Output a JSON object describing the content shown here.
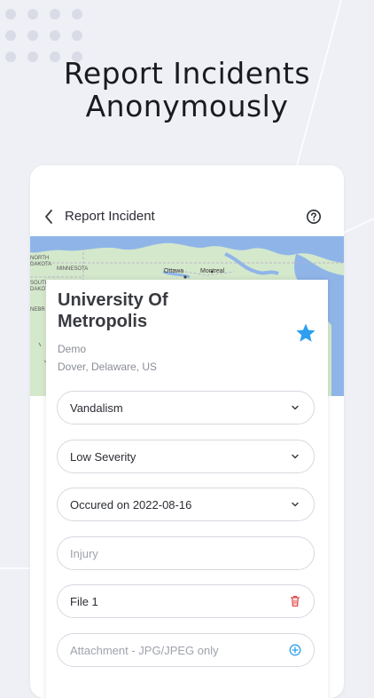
{
  "headline": {
    "line1": "Report Incidents",
    "line2": "Anonymously"
  },
  "appbar": {
    "title": "Report Incident"
  },
  "map": {
    "labels": [
      "NORTH",
      "DAKOTA",
      "MINNESOTA",
      "SOUTH",
      "DAKOTA",
      "NEBR"
    ],
    "cities": [
      "Ottawa",
      "Montreal"
    ]
  },
  "campus": {
    "name": "University Of Metropolis",
    "subtitle": "Demo",
    "location": "Dover, Delaware, US",
    "favorite_color": "#2d9ff0"
  },
  "form": {
    "incident_type": "Vandalism",
    "severity": "Low Severity",
    "date": "Occured on 2022-08-16",
    "injury_placeholder": "Injury",
    "file_label": "File 1",
    "attachment_placeholder": "Attachment - JPG/JPEG only"
  },
  "colors": {
    "accent": "#2d9ff0",
    "danger": "#e0484a",
    "background": "#eef0f6"
  },
  "icons": [
    "back-arrow-icon",
    "help-icon",
    "star-icon",
    "chevron-down-icon",
    "trash-icon",
    "add-circle-icon"
  ]
}
